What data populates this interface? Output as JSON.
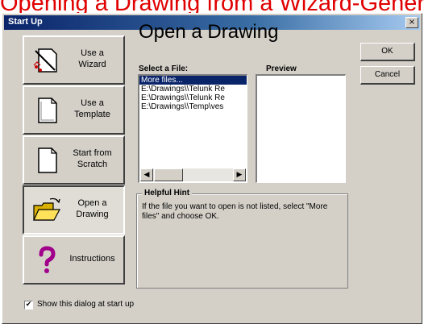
{
  "caption": "Opening a Drawing from a Wizard-Generated Template",
  "window": {
    "title": "Start Up",
    "close_symbol": "×"
  },
  "sidebar": {
    "buttons": [
      {
        "line1": "Use a",
        "line2": "Wizard",
        "icon": "wizard-icon"
      },
      {
        "line1": "Use a",
        "line2": "Template",
        "icon": "template-icon"
      },
      {
        "line1": "Start from",
        "line2": "Scratch",
        "icon": "blank-page-icon"
      },
      {
        "line1": "Open a",
        "line2": "Drawing",
        "icon": "open-folder-icon"
      },
      {
        "line1": "Instructions",
        "line2": "",
        "icon": "question-mark-icon"
      }
    ]
  },
  "main": {
    "heading": "Open a Drawing",
    "select_file_label": "Select a File:",
    "preview_label": "Preview",
    "files": [
      "More files...",
      "E:\\Drawings\\\\Telunk Re",
      "E:\\Drawings\\\\Telunk Re",
      "E:\\Drawings\\\\Temp\\ves"
    ],
    "selected_index": 0
  },
  "hint": {
    "title": "Helpful Hint",
    "text": "If the file you want to open is not listed, select \"More files\" and choose OK."
  },
  "actions": {
    "ok": "OK",
    "cancel": "Cancel"
  },
  "footer": {
    "show_dialog_label": "Show this dialog at start up",
    "checked": true,
    "check_mark": "✔"
  },
  "colors": {
    "title_bar": "#0a246a",
    "selection": "#0a246a",
    "caption_text": "#e00000",
    "dialog_bg": "#d4d0c8"
  }
}
